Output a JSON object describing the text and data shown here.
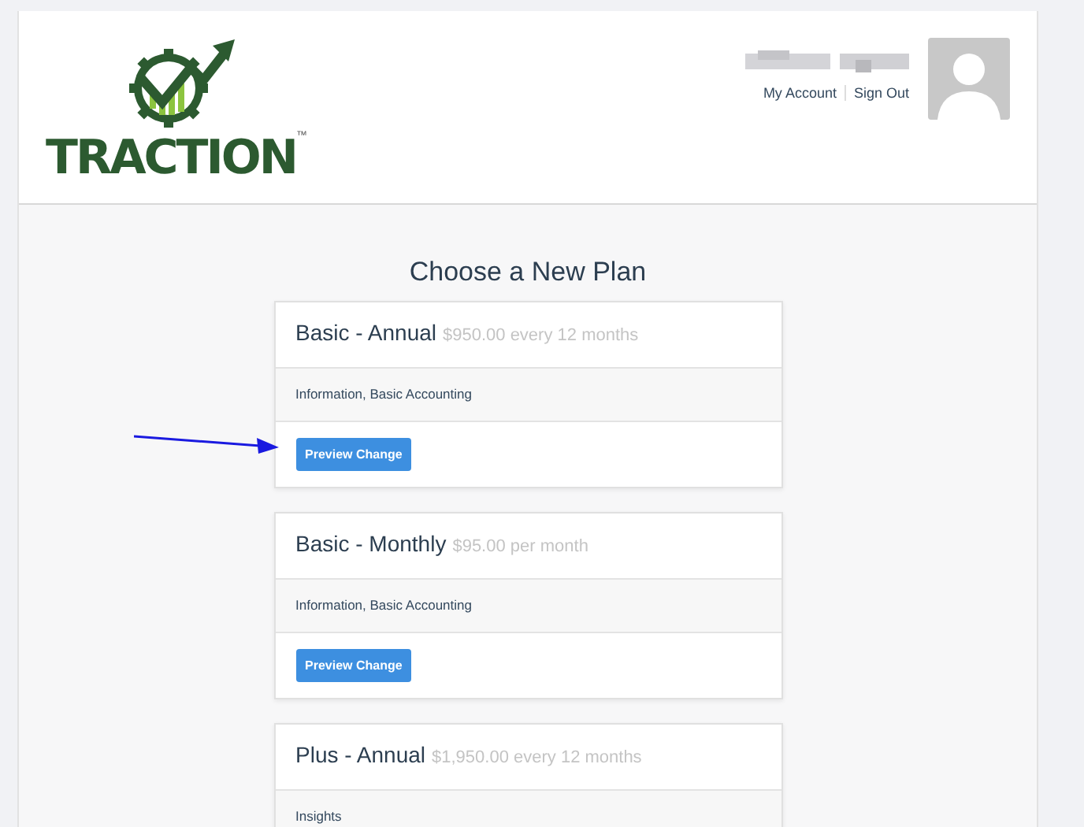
{
  "logo": {
    "name": "TRACTION",
    "trademark": "™"
  },
  "user": {
    "links": [
      {
        "label": "My Account"
      },
      {
        "label": "Sign Out"
      }
    ]
  },
  "title": "Choose a New Plan",
  "plans": [
    {
      "name": "Basic - Annual",
      "price": "$950.00 every 12 months",
      "features": "Information, Basic Accounting",
      "button": "Preview Change"
    },
    {
      "name": "Basic - Monthly",
      "price": "$95.00 per month",
      "features": "Information, Basic Accounting",
      "button": "Preview Change"
    },
    {
      "name": "Plus - Annual",
      "price": "$1,950.00 every 12 months",
      "features": "Insights"
    }
  ]
}
